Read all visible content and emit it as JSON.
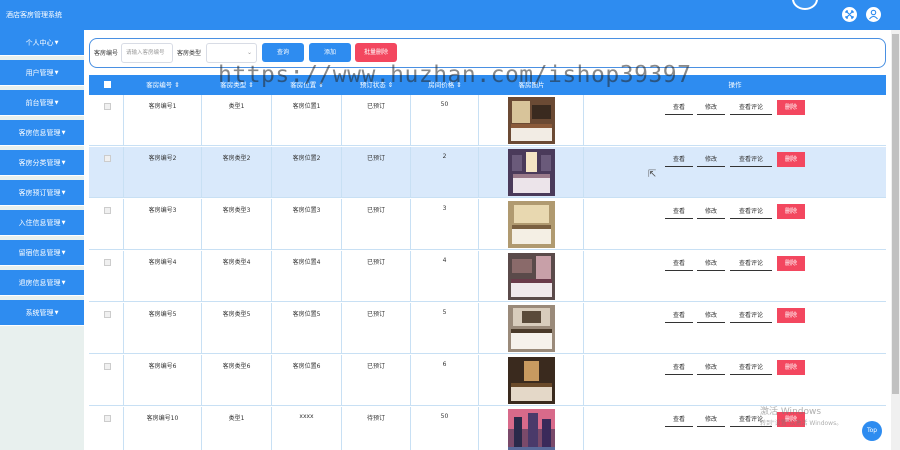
{
  "header": {
    "app_title": "酒店客房管理系统"
  },
  "sidebar": {
    "items": [
      {
        "label": "个人中心"
      },
      {
        "label": "用户管理"
      },
      {
        "label": "前台管理"
      },
      {
        "label": "客房信息管理"
      },
      {
        "label": "客房分类管理"
      },
      {
        "label": "客房预订管理"
      },
      {
        "label": "入住信息管理"
      },
      {
        "label": "留宿信息管理"
      },
      {
        "label": "退房信息管理"
      },
      {
        "label": "系统管理"
      }
    ]
  },
  "search": {
    "room_no_label": "客房编号",
    "room_no_placeholder": "请输入客房编号",
    "room_type_label": "客房类型",
    "query_button": "查询",
    "add_button": "添加",
    "batch_delete_button": "批量删除"
  },
  "table": {
    "headers": [
      "客房编号",
      "客房类型",
      "客房位置",
      "预订状态",
      "房间价格",
      "客房图片",
      "操作"
    ],
    "rows": [
      {
        "room_no": "客房编号1",
        "room_type": "类型1",
        "location": "客房位置1",
        "status": "已预订",
        "price": "50"
      },
      {
        "room_no": "客房编号2",
        "room_type": "客房类型2",
        "location": "客房位置2",
        "status": "已预订",
        "price": "2"
      },
      {
        "room_no": "客房编号3",
        "room_type": "客房类型3",
        "location": "客房位置3",
        "status": "已预订",
        "price": "3"
      },
      {
        "room_no": "客房编号4",
        "room_type": "客房类型4",
        "location": "客房位置4",
        "status": "已预订",
        "price": "4"
      },
      {
        "room_no": "客房编号5",
        "room_type": "客房类型5",
        "location": "客房位置5",
        "status": "已预订",
        "price": "5"
      },
      {
        "room_no": "客房编号6",
        "room_type": "客房类型6",
        "location": "客房位置6",
        "status": "已预订",
        "price": "6"
      },
      {
        "room_no": "客房编号10",
        "room_type": "类型1",
        "location": "xxxx",
        "status": "待预订",
        "price": "50"
      }
    ],
    "actions": {
      "view": "查看",
      "edit": "修改",
      "view_reviews": "查看评论",
      "delete": "删除"
    }
  },
  "top_button": "Top",
  "watermark": "https://www.huzhan.com/ishop39397",
  "os_watermark": {
    "line1": "激活 Windows",
    "line2": "转到\"设置\"以激活 Windows。"
  },
  "colors": {
    "primary": "#2e8cf0",
    "danger": "#f3475f",
    "selected_row": "#d9e9fb"
  }
}
